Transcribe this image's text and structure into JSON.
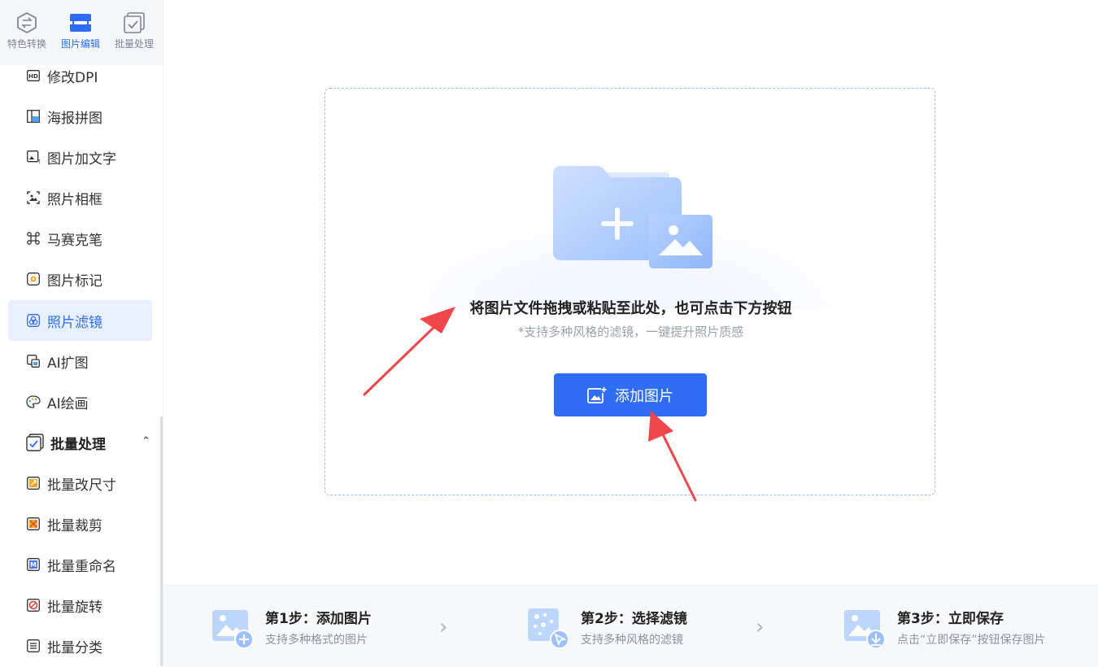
{
  "topnav": [
    {
      "label": "特色转换",
      "icon": "swap-icon"
    },
    {
      "label": "图片编辑",
      "icon": "image-edit-icon",
      "active": true
    },
    {
      "label": "批量处理",
      "icon": "batch-check-icon"
    }
  ],
  "menu": [
    {
      "label": "修改DPI",
      "icon": "hd-icon"
    },
    {
      "label": "海报拼图",
      "icon": "collage-icon"
    },
    {
      "label": "图片加文字",
      "icon": "image-text-icon"
    },
    {
      "label": "照片相框",
      "icon": "frame-icon"
    },
    {
      "label": "马赛克笔",
      "icon": "mosaic-icon"
    },
    {
      "label": "图片标记",
      "icon": "marker-icon"
    },
    {
      "label": "照片滤镜",
      "icon": "filter-icon",
      "active": true
    },
    {
      "label": "AI扩图",
      "icon": "ai-expand-icon"
    },
    {
      "label": "AI绘画",
      "icon": "ai-paint-icon"
    },
    {
      "label": "批量处理",
      "icon": "batch-check-icon",
      "group": true
    },
    {
      "label": "批量改尺寸",
      "icon": "batch-resize-icon"
    },
    {
      "label": "批量裁剪",
      "icon": "batch-crop-icon"
    },
    {
      "label": "批量重命名",
      "icon": "batch-rename-icon"
    },
    {
      "label": "批量旋转",
      "icon": "batch-rotate-icon"
    },
    {
      "label": "批量分类",
      "icon": "batch-sort-icon"
    }
  ],
  "dropzone": {
    "title": "将图片文件拖拽或粘贴至此处，也可点击下方按钮",
    "subtitle": "*支持多种风格的滤镜，一键提升照片质感",
    "button": "添加图片"
  },
  "steps": [
    {
      "title": "第1步：添加图片",
      "desc": "支持多种格式的图片",
      "icon": "add-image-step-icon"
    },
    {
      "title": "第2步：选择滤镜",
      "desc": "支持多种风格的滤镜",
      "icon": "filter-select-step-icon"
    },
    {
      "title": "第3步：立即保存",
      "desc": "点击“立即保存”按钮保存图片",
      "icon": "save-step-icon"
    }
  ],
  "colors": {
    "accent": "#2f6df5",
    "active_bg": "#e8efff",
    "annotation_arrow": "#f0454b"
  }
}
